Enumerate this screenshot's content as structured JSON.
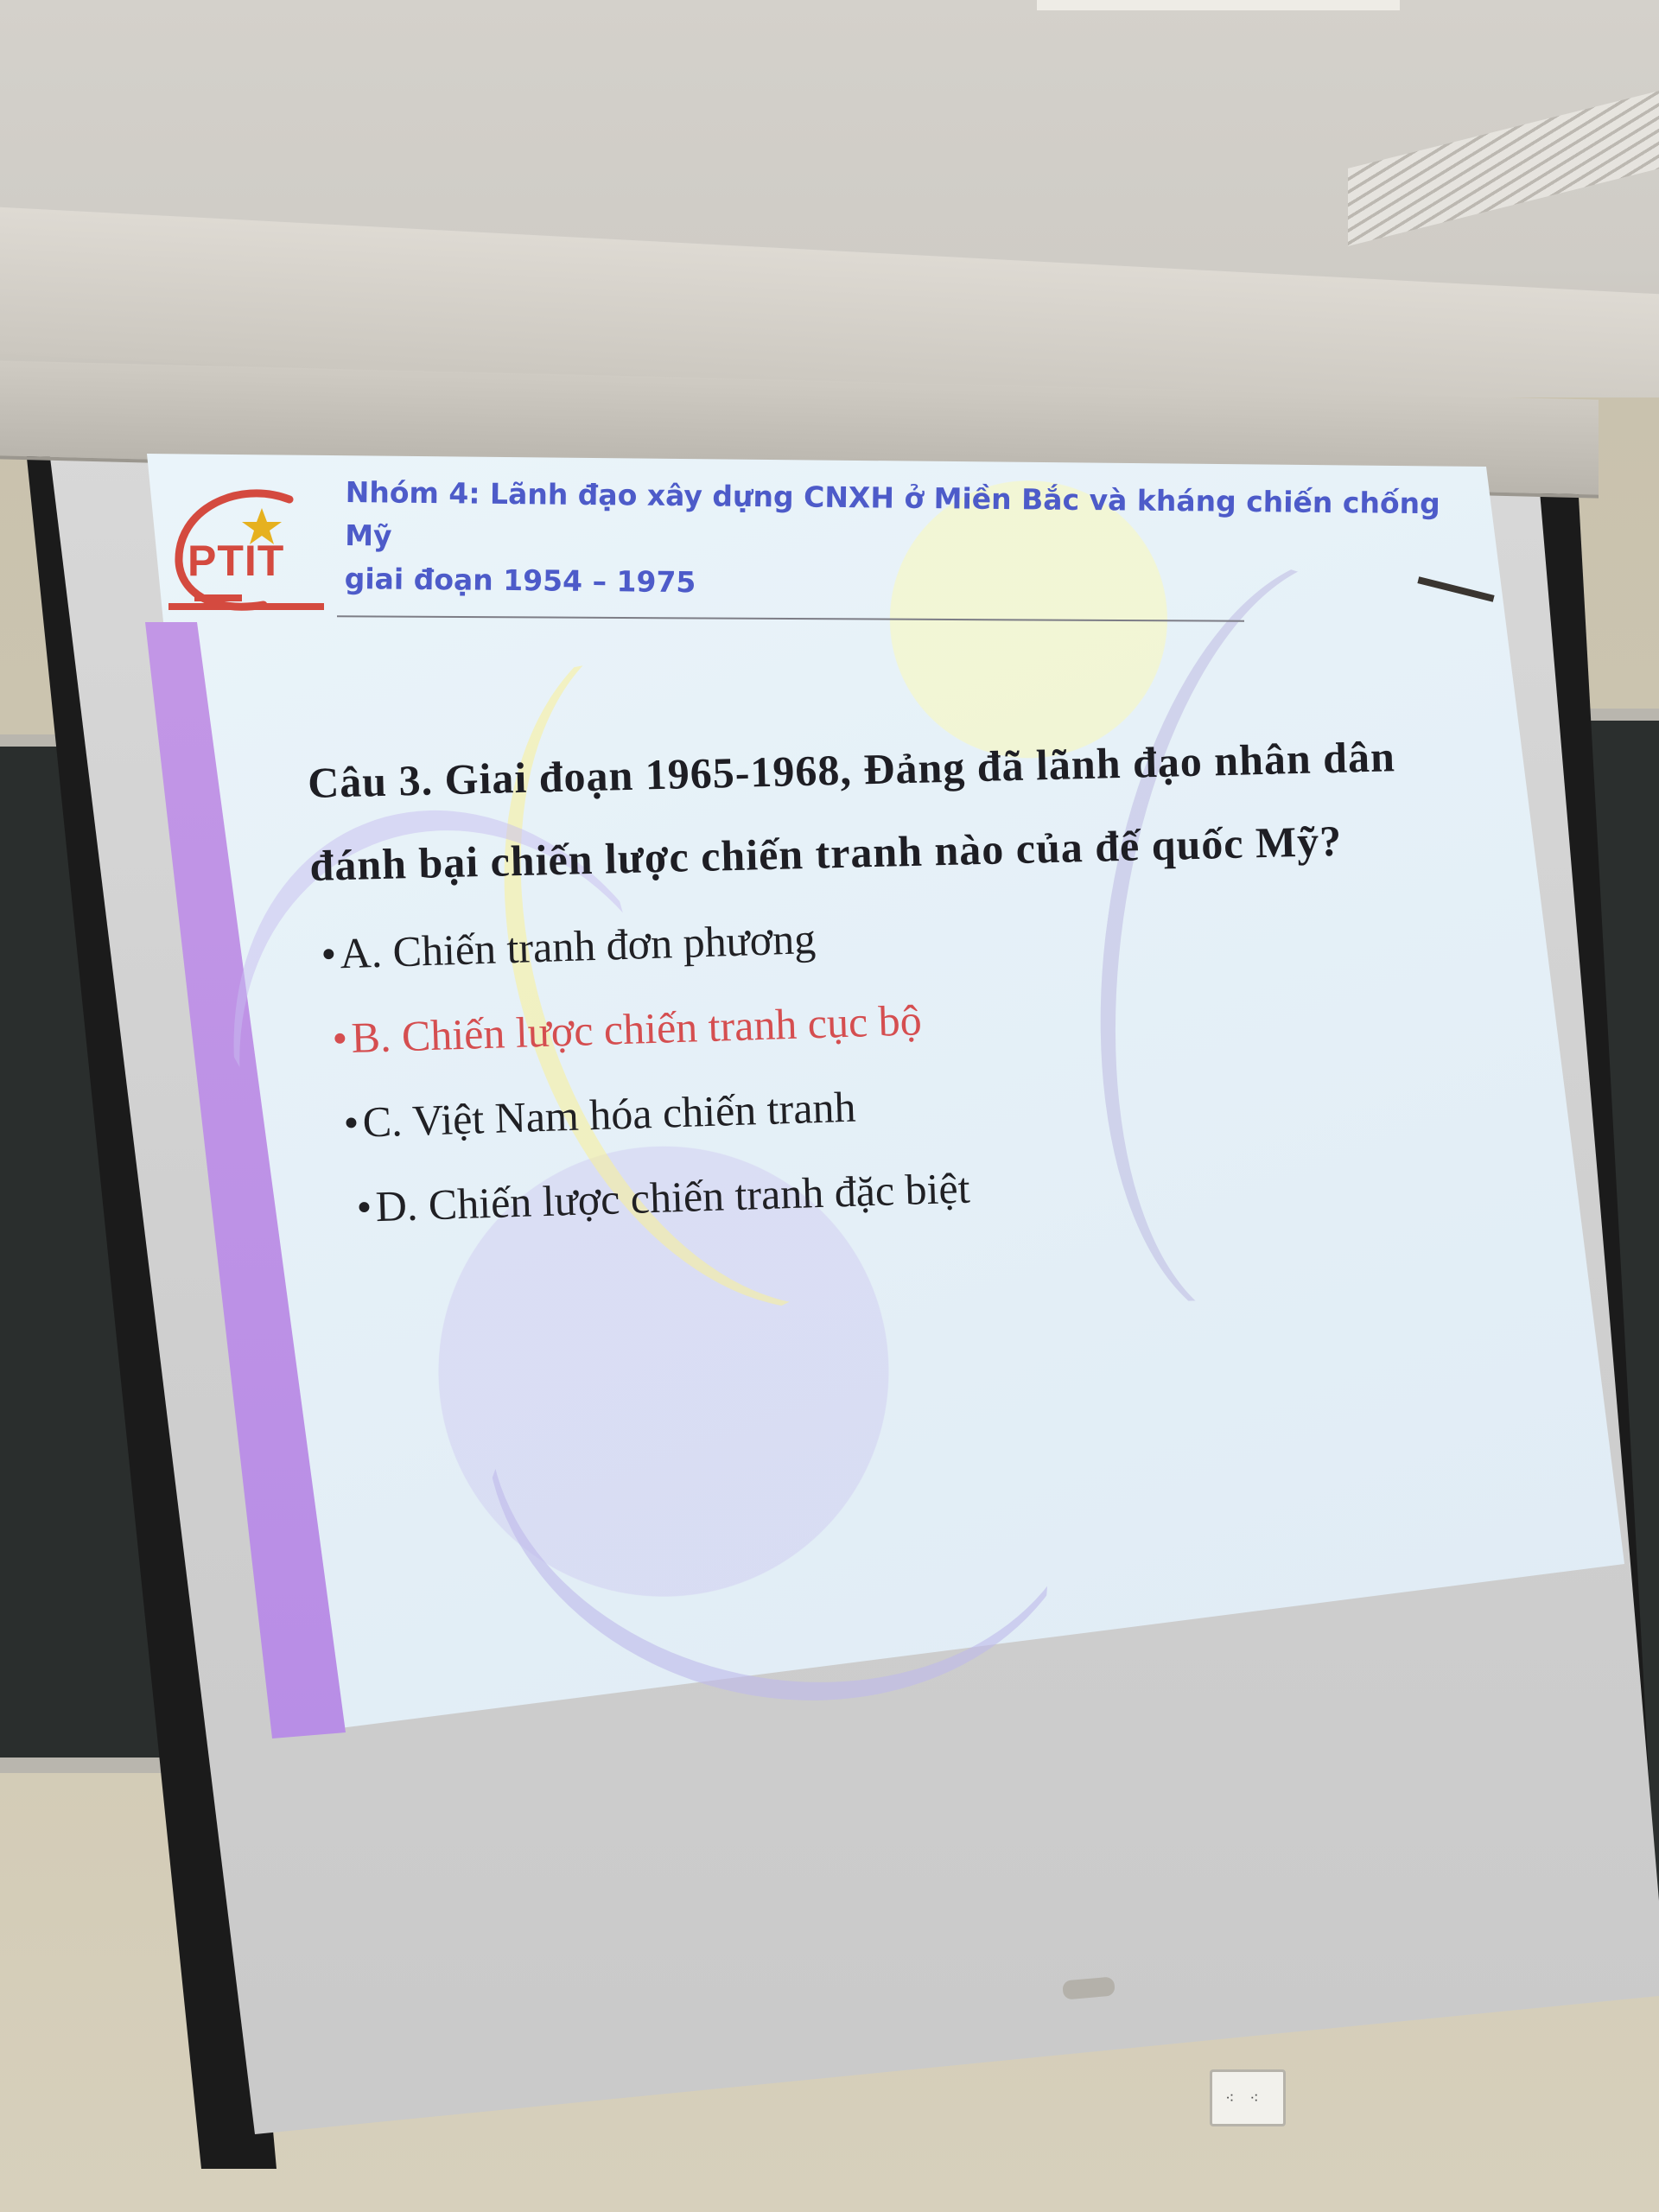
{
  "slide": {
    "logo_text": "PTIT",
    "header_line_1": "Nhóm 4: Lãnh đạo xây dựng CNXH ở Miền Bắc và kháng chiến chống Mỹ",
    "header_line_2": "giai đoạn 1954 – 1975",
    "question_line_1": "Câu 3. Giai đoạn 1965-1968, Đảng đã lãnh đạo nhân dân",
    "question_line_2": "đánh bại chiến lược chiến tranh nào của đế quốc Mỹ?",
    "options": [
      {
        "bullet": "•",
        "text": "A. Chiến tranh đơn phương"
      },
      {
        "bullet": "•",
        "text": "B. Chiến lược chiến tranh cục bộ"
      },
      {
        "bullet": "•",
        "text": "C. Việt Nam hóa chiến tranh"
      },
      {
        "bullet": "•",
        "text": "D. Chiến lược chiến tranh đặc biệt"
      }
    ],
    "colors": {
      "header": "#4d5bc9",
      "logo": "#d44a3f",
      "highlighted_option": "#d54e50",
      "question": "#1e1e24",
      "side_band": "#c89be6"
    }
  },
  "outlet": {
    "label": "⁖ ⁖"
  }
}
